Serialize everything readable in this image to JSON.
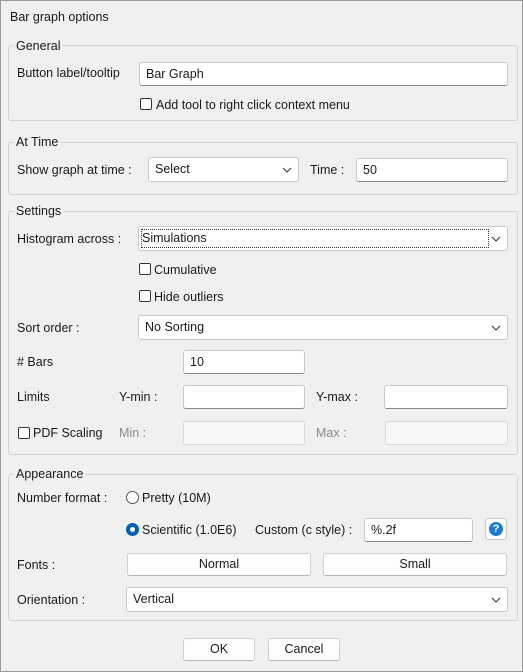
{
  "window": {
    "title": "Bar graph options"
  },
  "general": {
    "legend": "General",
    "button_label_label": "Button label/tooltip",
    "button_label_value": "Bar Graph",
    "add_tool_label": "Add tool to right click context menu"
  },
  "at_time": {
    "legend": "At Time",
    "show_graph_label": "Show graph at time :",
    "show_graph_value": "Select",
    "time_label": "Time :",
    "time_value": "50"
  },
  "settings": {
    "legend": "Settings",
    "histogram_label": "Histogram across :",
    "histogram_value": "Simulations",
    "cumulative_label": "Cumulative",
    "hide_outliers_label": "Hide outliers",
    "sort_order_label": "Sort order :",
    "sort_order_value": "No Sorting",
    "bars_label": "# Bars",
    "bars_value": "10",
    "limits_label": "Limits",
    "ymin_label": "Y-min :",
    "ymax_label": "Y-max :",
    "pdf_scaling_label": "PDF Scaling",
    "min_label": "Min :",
    "max_label": "Max :"
  },
  "appearance": {
    "legend": "Appearance",
    "number_format_label": "Number format :",
    "pretty_label": "Pretty (10M)",
    "scientific_label": "Scientific (1.0E6)",
    "custom_label": "Custom (c style) :",
    "custom_value": "%.2f",
    "help_label": "?",
    "fonts_label": "Fonts :",
    "normal_button": "Normal",
    "small_button": "Small",
    "orientation_label": "Orientation :",
    "orientation_value": "Vertical"
  },
  "footer": {
    "ok": "OK",
    "cancel": "Cancel"
  }
}
